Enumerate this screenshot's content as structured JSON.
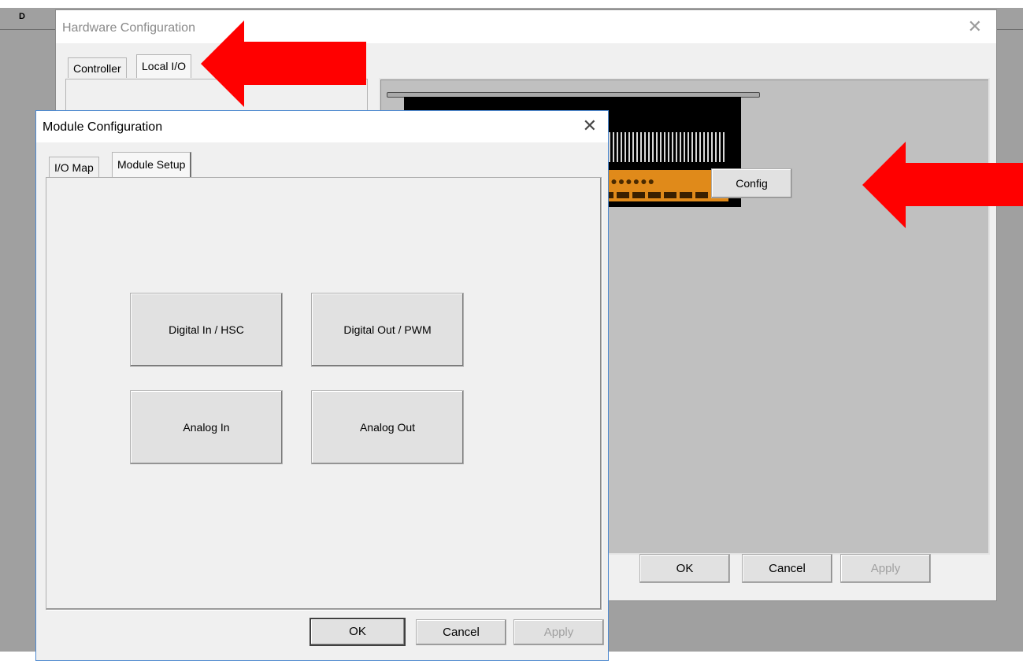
{
  "background": {
    "corner_letter": "D"
  },
  "hardware_config": {
    "title": "Hardware Configuration",
    "tabs": [
      "Controller",
      "Local I/O"
    ],
    "config_label": "Config",
    "ok_label": "OK",
    "cancel_label": "Cancel",
    "apply_label": "Apply"
  },
  "module_config": {
    "title": "Module Configuration",
    "tabs": [
      "I/O Map",
      "Module Setup"
    ],
    "buttons": {
      "digital_in": "Digital In / HSC",
      "digital_out": "Digital Out / PWM",
      "analog_in": "Analog In",
      "analog_out": "Analog Out"
    },
    "ok_label": "OK",
    "cancel_label": "Cancel",
    "apply_label": "Apply"
  },
  "colors": {
    "annotation_arrow": "#ff0000",
    "dialog_bg": "#f0f0f0",
    "panel_bg": "#c0c0c0",
    "terminal": "#e08a1a"
  }
}
